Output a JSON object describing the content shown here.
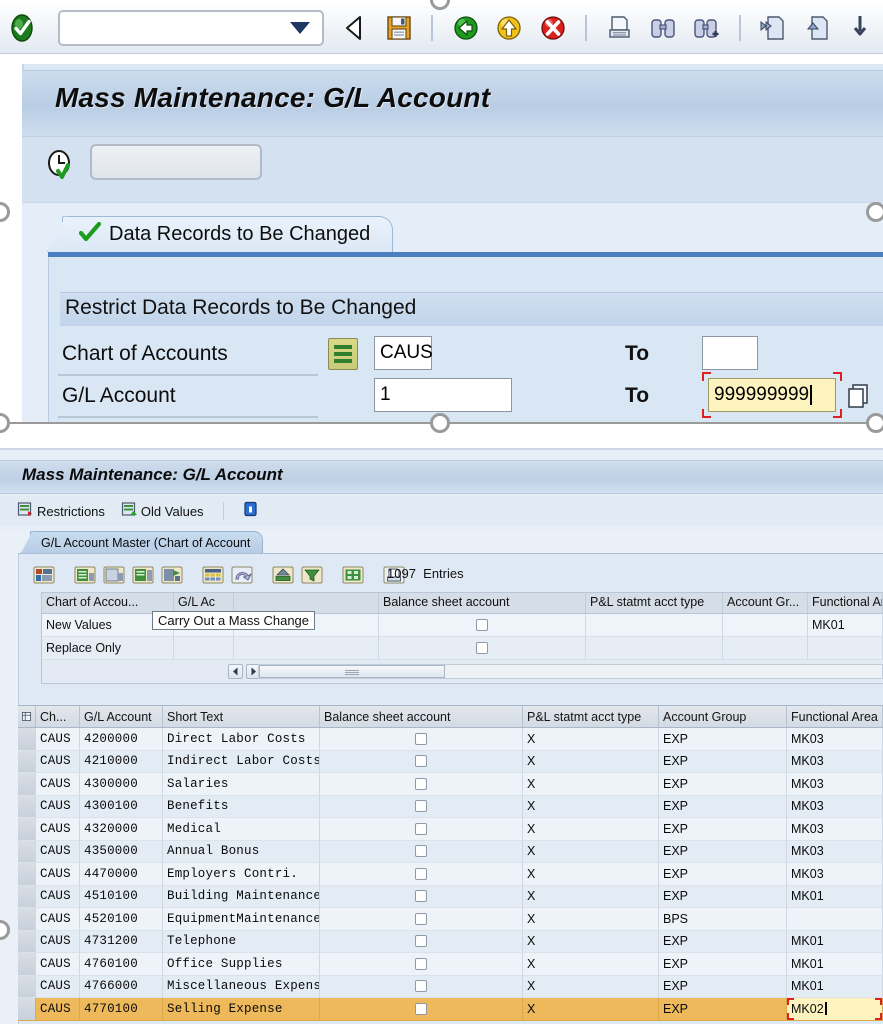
{
  "top_window": {
    "command_field": {
      "value": "",
      "placeholder": ""
    },
    "toolbar_icons": [
      "enter-ok-icon",
      "back-icon",
      "save-icon",
      "exit-icon",
      "cancel-icon",
      "print-icon",
      "find-icon",
      "find-next-icon",
      "first-page-icon",
      "previous-page-icon",
      "next-page-icon"
    ],
    "screen_title": "Mass Maintenance: G/L Account",
    "app_toolbar": {
      "clock_icon": "clock-icon",
      "field_value": ""
    },
    "tab": {
      "label": "Data Records to Be Changed",
      "check_icon": "green-check-icon"
    },
    "group_title": "Restrict Data Records to Be Changed",
    "fields": [
      {
        "label": "Chart of Accounts",
        "selection_icon": "multiple-selection-icon",
        "from_value": "CAUS",
        "to_label": "To",
        "to_value": "",
        "focused": false
      },
      {
        "label": "G/L Account",
        "selection_icon": "",
        "from_value": "1",
        "to_label": "To",
        "to_value": "999999999",
        "focused": true,
        "multiple_selection_icon": "multiple-selection-button"
      }
    ]
  },
  "bottom_window": {
    "title": "Mass Maintenance: G/L Account",
    "app_toolbar": [
      {
        "label": "Restrictions",
        "icon": "restrictions-icon"
      },
      {
        "label": "Old Values",
        "icon": "old-values-icon"
      },
      {
        "label": "",
        "icon": "info-icon"
      }
    ],
    "tab": {
      "label": "G/L Account Master (Chart of Account"
    },
    "grid_toolbar_icons": [
      "mass-change-icon",
      "detail-icon",
      "display-icon",
      "insert-row-icon",
      "delete-row-icon",
      "table-settings-icon",
      "undo-icon",
      "sort-ascending-icon",
      "filter-icon",
      "layout-icon",
      "print-preview-icon"
    ],
    "entries_count": "1097",
    "entries_label": "Entries",
    "tooltip": "Carry Out a Mass Change",
    "mini_table": {
      "columns": [
        "Chart of Accou...",
        "G/L Ac",
        "",
        "Balance sheet account",
        "P&L statmt acct type",
        "Account Gr...",
        "Functional Are"
      ],
      "rows": [
        {
          "label": "New Values",
          "gl_account": "",
          "short_text": "",
          "balance_sheet": false,
          "pl_type": "",
          "account_group": "",
          "functional_area": "MK01"
        },
        {
          "label": "Replace Only",
          "gl_account": "",
          "short_text": "",
          "balance_sheet": false,
          "pl_type": "",
          "account_group": "",
          "functional_area": ""
        }
      ],
      "scroll_left_icon": "scroll-left-icon",
      "scroll_right_icon": "scroll-right-icon"
    },
    "grid": {
      "select_all_icon": "select-all-icon",
      "columns": [
        "Ch...",
        "G/L Account",
        "Short Text",
        "Balance sheet account",
        "P&L statmt acct type",
        "Account Group",
        "Functional Area"
      ],
      "rows": [
        {
          "coa": "CAUS",
          "account": "4200000",
          "short_text": "Direct Labor Costs",
          "balance_sheet": false,
          "pl_type": "X",
          "account_group": "EXP",
          "functional_area": "MK03",
          "selected": false
        },
        {
          "coa": "CAUS",
          "account": "4210000",
          "short_text": "Indirect Labor Costs",
          "balance_sheet": false,
          "pl_type": "X",
          "account_group": "EXP",
          "functional_area": "MK03",
          "selected": false
        },
        {
          "coa": "CAUS",
          "account": "4300000",
          "short_text": "Salaries",
          "balance_sheet": false,
          "pl_type": "X",
          "account_group": "EXP",
          "functional_area": "MK03",
          "selected": false
        },
        {
          "coa": "CAUS",
          "account": "4300100",
          "short_text": "Benefits",
          "balance_sheet": false,
          "pl_type": "X",
          "account_group": "EXP",
          "functional_area": "MK03",
          "selected": false
        },
        {
          "coa": "CAUS",
          "account": "4320000",
          "short_text": "Medical",
          "balance_sheet": false,
          "pl_type": "X",
          "account_group": "EXP",
          "functional_area": "MK03",
          "selected": false
        },
        {
          "coa": "CAUS",
          "account": "4350000",
          "short_text": "Annual Bonus",
          "balance_sheet": false,
          "pl_type": "X",
          "account_group": "EXP",
          "functional_area": "MK03",
          "selected": false
        },
        {
          "coa": "CAUS",
          "account": "4470000",
          "short_text": "Employers Contri.",
          "balance_sheet": false,
          "pl_type": "X",
          "account_group": "EXP",
          "functional_area": "MK03",
          "selected": false
        },
        {
          "coa": "CAUS",
          "account": "4510100",
          "short_text": "Building Maintenance",
          "balance_sheet": false,
          "pl_type": "X",
          "account_group": "EXP",
          "functional_area": "MK01",
          "selected": false
        },
        {
          "coa": "CAUS",
          "account": "4520100",
          "short_text": "EquipmentMaintenance",
          "balance_sheet": false,
          "pl_type": "X",
          "account_group": "BPS",
          "functional_area": "",
          "selected": false
        },
        {
          "coa": "CAUS",
          "account": "4731200",
          "short_text": "Telephone",
          "balance_sheet": false,
          "pl_type": "X",
          "account_group": "EXP",
          "functional_area": "MK01",
          "selected": false
        },
        {
          "coa": "CAUS",
          "account": "4760100",
          "short_text": "Office Supplies",
          "balance_sheet": false,
          "pl_type": "X",
          "account_group": "EXP",
          "functional_area": "MK01",
          "selected": false
        },
        {
          "coa": "CAUS",
          "account": "4766000",
          "short_text": "Miscellaneous Expens",
          "balance_sheet": false,
          "pl_type": "X",
          "account_group": "EXP",
          "functional_area": "MK01",
          "selected": false
        },
        {
          "coa": "CAUS",
          "account": "4770100",
          "short_text": "Selling Expense",
          "balance_sheet": false,
          "pl_type": "X",
          "account_group": "EXP",
          "functional_area": "MK02",
          "selected": true,
          "editing_cell": "functional_area"
        }
      ]
    }
  },
  "colors": {
    "selected_row": "#edb95a",
    "focus_field": "#fdf3bf",
    "focus_marker": "#e02020",
    "tab_accent": "#4a7fc1",
    "header_band": "#b9cde4"
  }
}
